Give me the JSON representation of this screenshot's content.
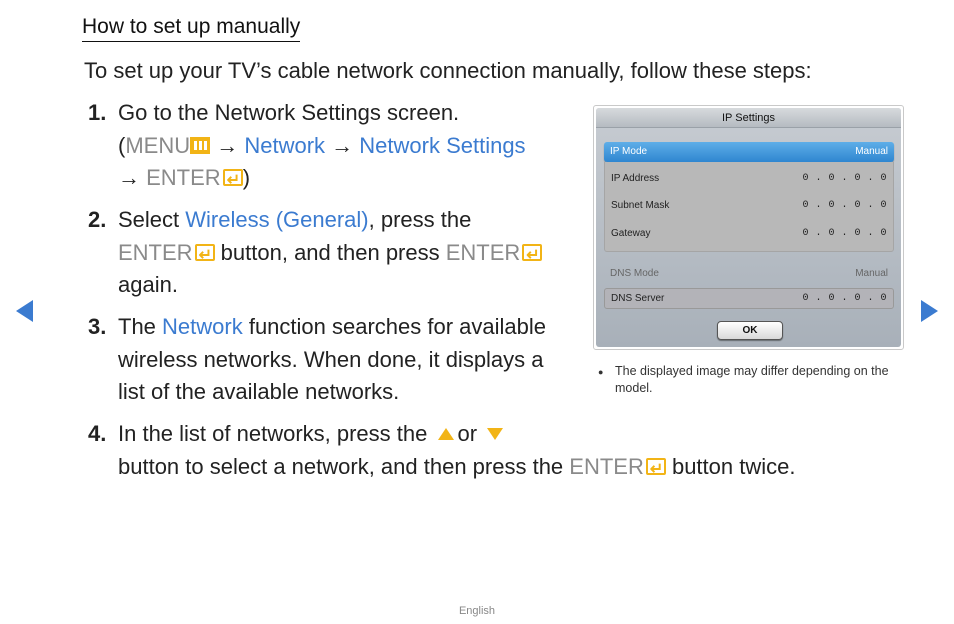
{
  "heading": "How to set up manually",
  "intro": "To set up your TV’s cable network connection manually, follow these steps:",
  "steps": {
    "s1": {
      "num": "1.",
      "line1": "Go to the Network Settings screen.",
      "open": "(",
      "menu": "MENU",
      "arrow1": " → ",
      "network": "Network",
      "arrow2": " → ",
      "network_settings": "Network Settings",
      "arrow3": "→ ",
      "enter": "ENTER",
      "close": ")"
    },
    "s2": {
      "num": "2.",
      "select": "Select ",
      "wireless": "Wireless (General)",
      "press_the": ", press the",
      "enter1": "ENTER",
      "mid": " button, and then press ",
      "enter2": "ENTER",
      "again": "again."
    },
    "s3": {
      "num": "3.",
      "the": "The ",
      "network": "Network",
      "rest1": " function searches for available",
      "line2": "wireless networks. When done, it displays a",
      "line3": "list of the available networks."
    },
    "s4": {
      "num": "4.",
      "part1": "In the list of networks, press the",
      "or": "or",
      "part2": "button to select a network, and then press the ",
      "enter": "ENTER",
      "part3": " button twice."
    }
  },
  "dialog": {
    "title": "IP Settings",
    "ip_mode": {
      "label": "IP Mode",
      "value": "Manual"
    },
    "rows": [
      {
        "label": "IP Address",
        "value": "0 . 0 . 0 . 0"
      },
      {
        "label": "Subnet Mask",
        "value": "0 . 0 . 0 . 0"
      },
      {
        "label": "Gateway",
        "value": "0 . 0 . 0 . 0"
      }
    ],
    "dns_mode": {
      "label": "DNS Mode",
      "value": "Manual"
    },
    "dns_server": {
      "label": "DNS Server",
      "value": "0 . 0 . 0 . 0"
    },
    "ok_label": "OK"
  },
  "note": {
    "bullet": "●",
    "text": "The displayed image may differ depending on the model."
  },
  "footer": "English",
  "nav": {
    "prev_icon": "triangle-left",
    "next_icon": "triangle-right"
  },
  "colors": {
    "accent_blue": "#3b7bd0",
    "icon_yellow": "#f2b416",
    "key_gray": "#8a8a8a"
  }
}
